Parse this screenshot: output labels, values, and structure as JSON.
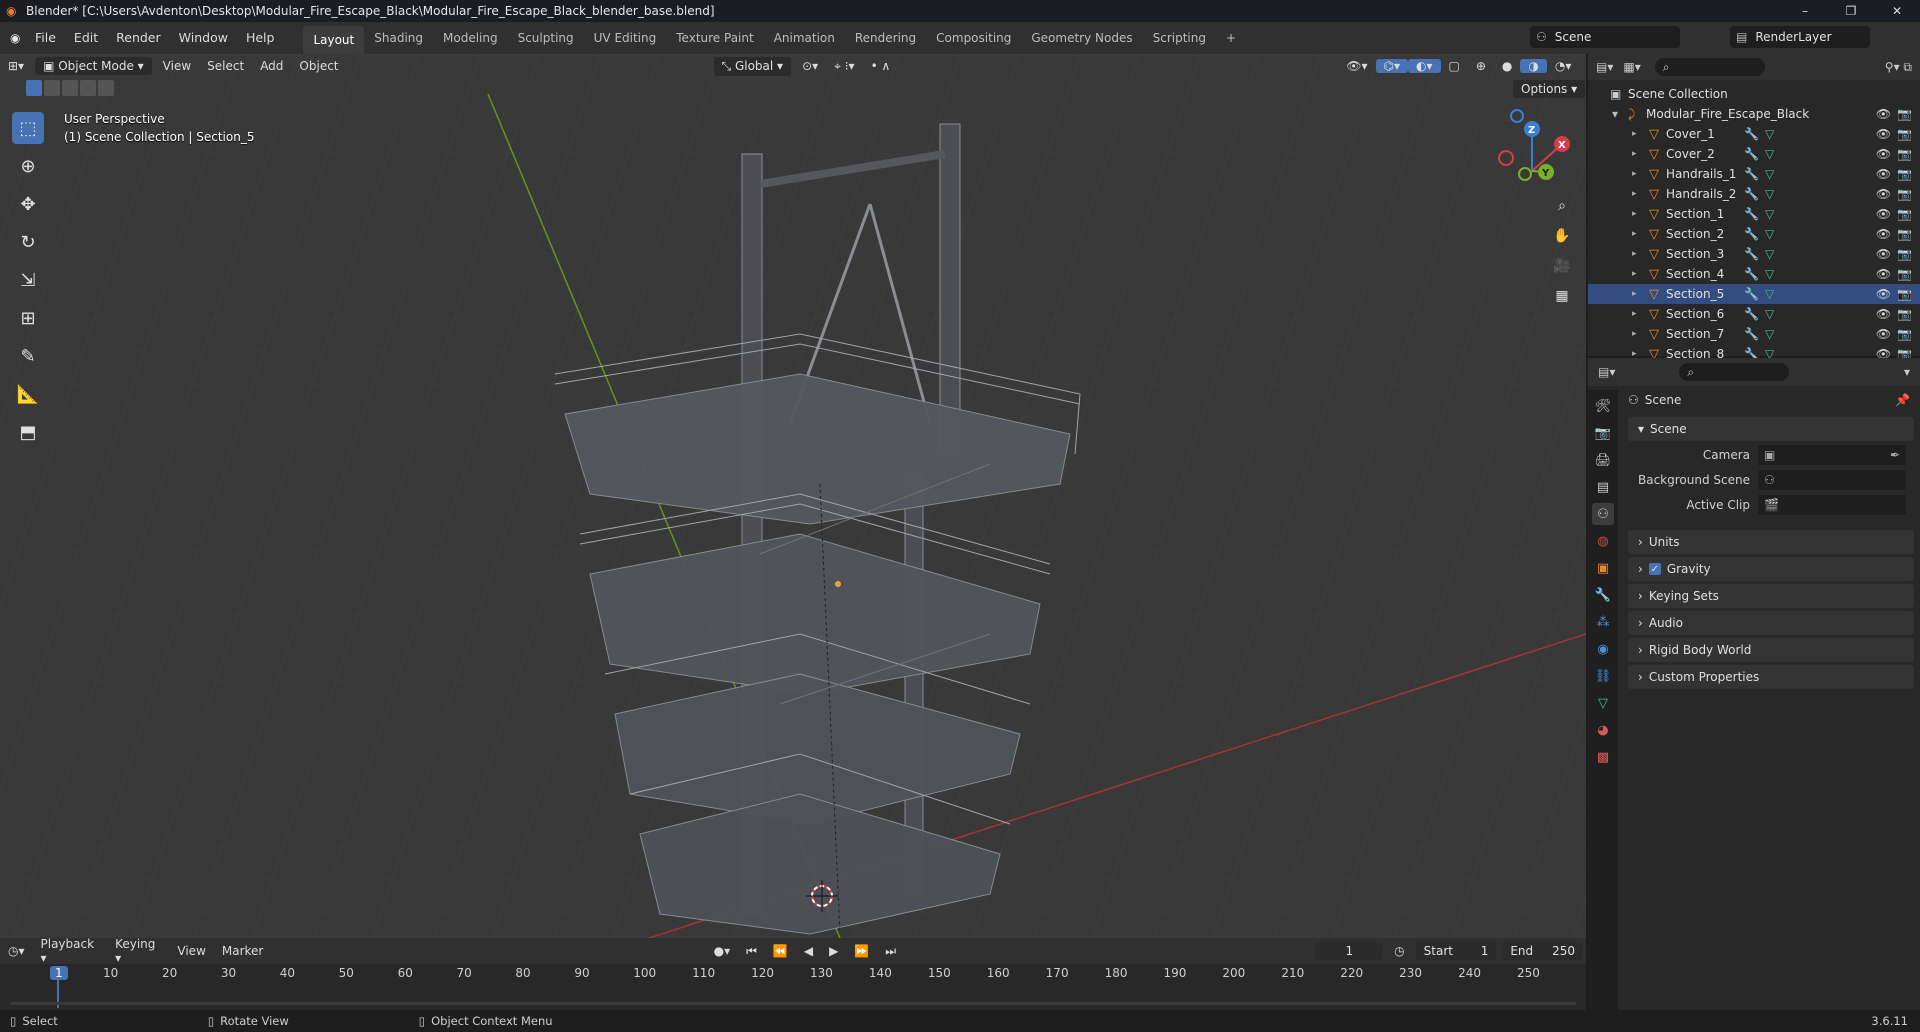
{
  "window": {
    "title": "Blender* [C:\\Users\\Avdenton\\Desktop\\Modular_Fire_Escape_Black\\Modular_Fire_Escape_Black_blender_base.blend]",
    "controls": [
      "–",
      "❐",
      "✕"
    ]
  },
  "menu": [
    "File",
    "Edit",
    "Render",
    "Window",
    "Help"
  ],
  "workspaces": [
    "Layout",
    "Shading",
    "Modeling",
    "Sculpting",
    "UV Editing",
    "Texture Paint",
    "Animation",
    "Rendering",
    "Compositing",
    "Geometry Nodes",
    "Scripting"
  ],
  "workspace_add": "+",
  "scene_selector": "Scene",
  "render_layer": "RenderLayer",
  "viewport": {
    "mode": "Object Mode",
    "menus": [
      "View",
      "Select",
      "Add",
      "Object"
    ],
    "transform_orientation": "Global",
    "options_label": "Options",
    "info_line1": "User Perspective",
    "info_line2": "(1) Scene Collection | Section_5",
    "gizmo": {
      "x": "X",
      "y": "Y",
      "z": "Z"
    }
  },
  "outliner": {
    "root": "Scene Collection",
    "collection": "Modular_Fire_Escape_Black",
    "items": [
      {
        "name": "Cover_1"
      },
      {
        "name": "Cover_2"
      },
      {
        "name": "Handrails_1"
      },
      {
        "name": "Handrails_2"
      },
      {
        "name": "Section_1"
      },
      {
        "name": "Section_2"
      },
      {
        "name": "Section_3"
      },
      {
        "name": "Section_4"
      },
      {
        "name": "Section_5"
      },
      {
        "name": "Section_6"
      },
      {
        "name": "Section_7"
      },
      {
        "name": "Section_8"
      }
    ]
  },
  "properties": {
    "context_title": "Scene",
    "scene_panel": "Scene",
    "camera_label": "Camera",
    "background_label": "Background Scene",
    "clip_label": "Active Clip",
    "panels": [
      "Units",
      "Gravity",
      "Keying Sets",
      "Audio",
      "Rigid Body World",
      "Custom Properties"
    ],
    "gravity_checked": true
  },
  "timeline": {
    "menus": [
      "Playback",
      "Keying",
      "View",
      "Marker"
    ],
    "current_frame": "1",
    "start_label": "Start",
    "start": "1",
    "end_label": "End",
    "end": "250",
    "ruler": [
      "1",
      "10",
      "20",
      "30",
      "40",
      "50",
      "60",
      "70",
      "80",
      "90",
      "100",
      "110",
      "120",
      "130",
      "140",
      "150",
      "160",
      "170",
      "180",
      "190",
      "200",
      "210",
      "220",
      "230",
      "240",
      "250"
    ]
  },
  "statusbar": {
    "select": "Select",
    "rotate": "Rotate View",
    "context": "Object Context Menu",
    "version": "3.6.11"
  }
}
